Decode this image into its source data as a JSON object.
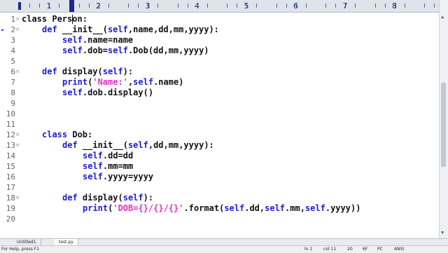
{
  "ruler": {
    "marks": [
      "1",
      "2",
      "3",
      "4",
      "5",
      "6",
      "7",
      "8"
    ]
  },
  "gutter": {
    "line_numbers": [
      "1",
      "2",
      "3",
      "4",
      "5",
      "6",
      "7",
      "8",
      "9",
      "10",
      "11",
      "12",
      "13",
      "14",
      "15",
      "16",
      "17",
      "18",
      "19",
      "20"
    ]
  },
  "editor": {
    "lines": [
      {
        "indent": 0,
        "parts": [
          {
            "t": "class Pers",
            "c": "plain"
          },
          {
            "t": "on:",
            "c": "plain"
          }
        ],
        "caret_after_first": true
      },
      {
        "indent": 4,
        "parts": [
          {
            "t": "def",
            "c": "kw"
          },
          {
            "t": " __init__(",
            "c": "plain"
          },
          {
            "t": "self",
            "c": "self"
          },
          {
            "t": ",name,dd,mm,yyyy):",
            "c": "plain"
          }
        ]
      },
      {
        "indent": 8,
        "parts": [
          {
            "t": "self",
            "c": "self"
          },
          {
            "t": ".name=name",
            "c": "plain"
          }
        ]
      },
      {
        "indent": 8,
        "parts": [
          {
            "t": "self",
            "c": "self"
          },
          {
            "t": ".dob=",
            "c": "plain"
          },
          {
            "t": "self",
            "c": "self"
          },
          {
            "t": ".Dob(dd,mm,yyyy)",
            "c": "plain"
          }
        ]
      },
      {
        "indent": 0,
        "parts": []
      },
      {
        "indent": 4,
        "parts": [
          {
            "t": "def",
            "c": "kw"
          },
          {
            "t": " display(",
            "c": "plain"
          },
          {
            "t": "self",
            "c": "self"
          },
          {
            "t": "):",
            "c": "plain"
          }
        ]
      },
      {
        "indent": 8,
        "parts": [
          {
            "t": "print",
            "c": "kw"
          },
          {
            "t": "(",
            "c": "plain"
          },
          {
            "t": "'Name:'",
            "c": "str"
          },
          {
            "t": ",",
            "c": "plain"
          },
          {
            "t": "self",
            "c": "self"
          },
          {
            "t": ".name)",
            "c": "plain"
          }
        ]
      },
      {
        "indent": 8,
        "parts": [
          {
            "t": "self",
            "c": "self"
          },
          {
            "t": ".dob.display()",
            "c": "plain"
          }
        ]
      },
      {
        "indent": 0,
        "parts": []
      },
      {
        "indent": 0,
        "parts": []
      },
      {
        "indent": 0,
        "parts": []
      },
      {
        "indent": 4,
        "parts": [
          {
            "t": "class",
            "c": "kw"
          },
          {
            "t": " Dob:",
            "c": "plain"
          }
        ]
      },
      {
        "indent": 8,
        "parts": [
          {
            "t": "def",
            "c": "kw"
          },
          {
            "t": " __init__(",
            "c": "plain"
          },
          {
            "t": "self",
            "c": "self"
          },
          {
            "t": ",dd,mm,yyyy):",
            "c": "plain"
          }
        ]
      },
      {
        "indent": 12,
        "parts": [
          {
            "t": "self",
            "c": "self"
          },
          {
            "t": ".dd=dd",
            "c": "plain"
          }
        ]
      },
      {
        "indent": 12,
        "parts": [
          {
            "t": "self",
            "c": "self"
          },
          {
            "t": ".mm=mm",
            "c": "plain"
          }
        ]
      },
      {
        "indent": 12,
        "parts": [
          {
            "t": "self",
            "c": "self"
          },
          {
            "t": ".yyyy=yyyy",
            "c": "plain"
          }
        ]
      },
      {
        "indent": 0,
        "parts": []
      },
      {
        "indent": 8,
        "parts": [
          {
            "t": "def",
            "c": "kw"
          },
          {
            "t": " display(",
            "c": "plain"
          },
          {
            "t": "self",
            "c": "self"
          },
          {
            "t": "):",
            "c": "plain"
          }
        ]
      },
      {
        "indent": 12,
        "parts": [
          {
            "t": "print",
            "c": "kw"
          },
          {
            "t": "(",
            "c": "plain"
          },
          {
            "t": "'DOB={}/{}/{}'",
            "c": "str"
          },
          {
            "t": ".format(",
            "c": "plain"
          },
          {
            "t": "self",
            "c": "self"
          },
          {
            "t": ".dd,",
            "c": "plain"
          },
          {
            "t": "self",
            "c": "self"
          },
          {
            "t": ".mm,",
            "c": "plain"
          },
          {
            "t": "self",
            "c": "self"
          },
          {
            "t": ".yyyy))",
            "c": "plain"
          }
        ]
      },
      {
        "indent": 0,
        "parts": []
      }
    ]
  },
  "tabs": [
    {
      "label": "Untitled1",
      "active": false
    },
    {
      "label": "test.py",
      "active": true
    }
  ],
  "status": {
    "help": "For Help, press F1",
    "ln": "ln 1",
    "col": "col 11",
    "num1": "20",
    "num2": "6F",
    "mode": "PC",
    "encoding": "ANSI"
  },
  "colors": {
    "keyword": "#1c1cd0",
    "string": "#e030c0",
    "ruler_bg": "#dfe3ea"
  }
}
